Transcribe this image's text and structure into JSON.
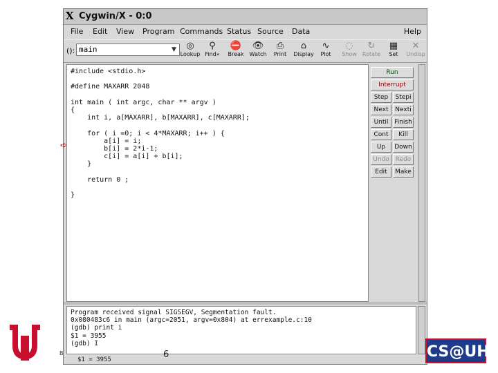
{
  "window": {
    "title": "Cygwin/X - 0:0"
  },
  "menubar": {
    "items": [
      {
        "label": "File",
        "underline": "F"
      },
      {
        "label": "Edit",
        "underline": "E"
      },
      {
        "label": "View",
        "underline": "V"
      },
      {
        "label": "Program",
        "underline": "P"
      },
      {
        "label": "Commands",
        "underline": "C"
      },
      {
        "label": "Status",
        "underline": "S"
      },
      {
        "label": "Source",
        "underline": "o"
      },
      {
        "label": "Data",
        "underline": "D"
      }
    ],
    "help": "Help"
  },
  "toolbar": {
    "arg_label": "():",
    "arg_value": "main",
    "clear_glyph": "▼",
    "buttons": [
      {
        "label": "Lookup",
        "icon": "lookup-icon",
        "glyph": "◎",
        "enabled": true
      },
      {
        "label": "Find»",
        "icon": "find-icon",
        "glyph": "⚲",
        "enabled": true
      },
      {
        "label": "Break",
        "icon": "break-icon",
        "glyph": "⛔",
        "enabled": true
      },
      {
        "label": "Watch",
        "icon": "watch-icon",
        "glyph": "👁",
        "enabled": true
      },
      {
        "label": "Print",
        "icon": "print-icon",
        "glyph": "⎙",
        "enabled": true
      },
      {
        "label": "Display",
        "icon": "display-icon",
        "glyph": "⌂",
        "enabled": true
      },
      {
        "label": "Plot",
        "icon": "plot-icon",
        "glyph": "∿",
        "enabled": true
      },
      {
        "label": "Show",
        "icon": "show-icon",
        "glyph": "◌",
        "enabled": false
      },
      {
        "label": "Rotate",
        "icon": "rotate-icon",
        "glyph": "↻",
        "enabled": false
      },
      {
        "label": "Set",
        "icon": "set-icon",
        "glyph": "▦",
        "enabled": true
      },
      {
        "label": "Undisp",
        "icon": "undisplay-icon",
        "glyph": "✕",
        "enabled": false
      }
    ]
  },
  "source": {
    "lines": [
      "#include <stdio.h>",
      "",
      "#define MAXARR 2048",
      "",
      "int main ( int argc, char ** argv )",
      "{",
      "    int i, a[MAXARR], b[MAXARR], c[MAXARR];",
      "",
      "    for ( i =0; i < 4*MAXARR; i++ ) {",
      "        a[i] = i;",
      "        b[i] = 2*i-1;",
      "        c[i] = a[i] + b[i];",
      "    }",
      "",
      "    return 0 ;",
      "",
      "}"
    ]
  },
  "commands": {
    "run": "Run",
    "interrupt": "Interrupt",
    "pairs": [
      [
        "Step",
        "Stepi"
      ],
      [
        "Next",
        "Nexti"
      ],
      [
        "Until",
        "Finish"
      ],
      [
        "Cont",
        "Kill"
      ],
      [
        "Up",
        "Down"
      ],
      [
        "Undo",
        "Redo"
      ],
      [
        "Edit",
        "Make"
      ]
    ],
    "disabled": [
      "Undo",
      "Redo"
    ]
  },
  "console": {
    "lines": [
      "Program received signal SIGSEGV, Segmentation fault.",
      "0x080483c6 in main (argc=2051, argv=0x804) at errexample.c:10",
      "(gdb) print i",
      "$1 = 3955",
      "(gdb) I"
    ]
  },
  "statusbar": {
    "text": "$1 = 3955"
  },
  "slide": {
    "page_number": "6",
    "side_letter": "B",
    "logo_text": "CS@UH"
  },
  "colors": {
    "uh_red": "#c8102e",
    "run_green": "#005000",
    "interrupt_red": "#8a0000",
    "exec_arrow": "#c00000"
  }
}
